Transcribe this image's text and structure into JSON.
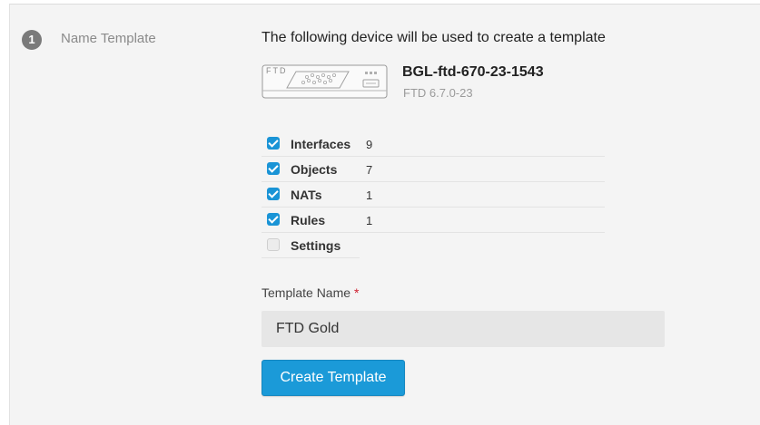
{
  "step": {
    "number": "1",
    "label": "Name Template"
  },
  "intro_text": "The following device will be used to create a template",
  "device": {
    "image_label": "FTD",
    "name": "BGL-ftd-670-23-1543",
    "version": "FTD 6.7.0-23"
  },
  "config_items": [
    {
      "label": "Interfaces",
      "count": "9",
      "checked": true
    },
    {
      "label": "Objects",
      "count": "7",
      "checked": true
    },
    {
      "label": "NATs",
      "count": "1",
      "checked": true
    },
    {
      "label": "Rules",
      "count": "1",
      "checked": true
    },
    {
      "label": "Settings",
      "count": "",
      "checked": false
    }
  ],
  "template_name": {
    "label": "Template Name",
    "required_mark": "*",
    "value": "FTD Gold"
  },
  "create_button_label": "Create Template",
  "colors": {
    "accent": "#1b9ad8",
    "checkbox_on": "#1a94d6",
    "required": "#cf2030",
    "panel_bg": "#f4f4f4"
  }
}
